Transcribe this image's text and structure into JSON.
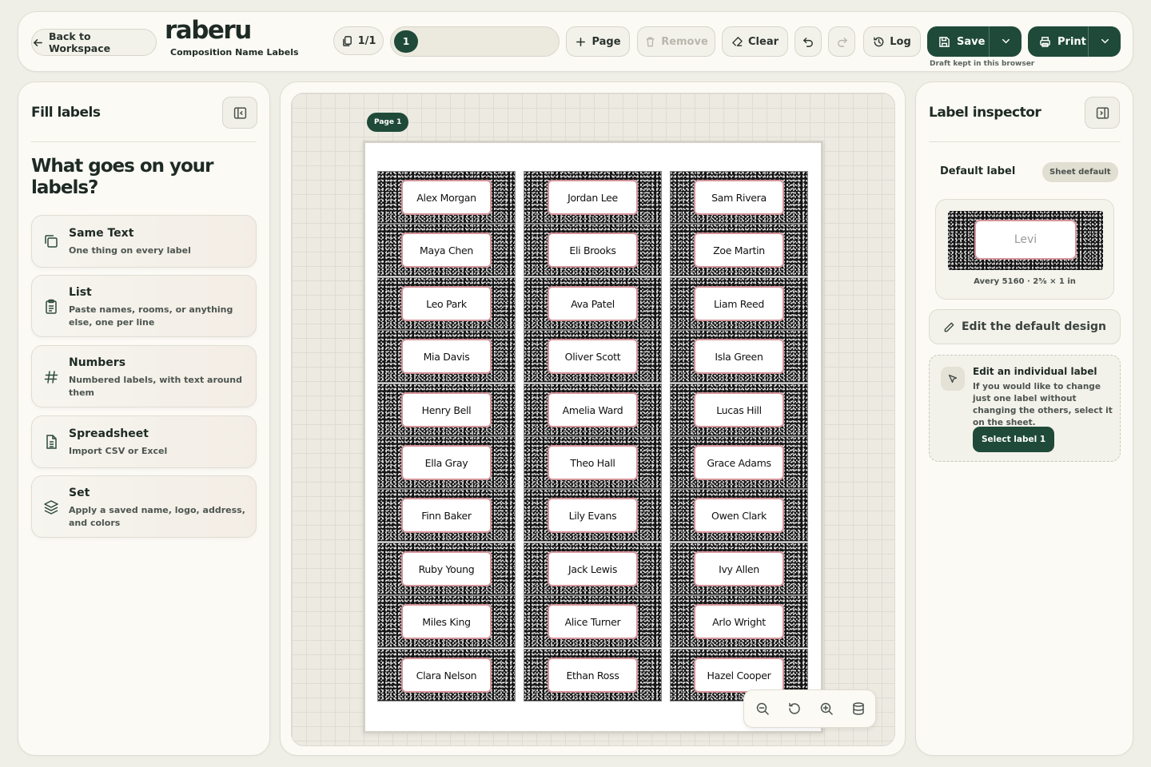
{
  "topbar": {
    "back_label": "Back to Workspace",
    "logo": "raberu",
    "subtitle": "Composition Name Labels",
    "page_count": "1/1",
    "page_chip": "1",
    "add_page_label": "Page",
    "remove_label": "Remove",
    "clear_label": "Clear",
    "log_label": "Log",
    "save_label": "Save",
    "print_label": "Print",
    "draft_note": "Draft kept in this browser"
  },
  "left": {
    "title": "Fill labels",
    "heading": "What goes on your labels?",
    "options": [
      {
        "title": "Same Text",
        "desc": "One thing on every label",
        "icon": "copy-icon"
      },
      {
        "title": "List",
        "desc": "Paste names, rooms, or anything else, one per line",
        "icon": "clipboard-list-icon"
      },
      {
        "title": "Numbers",
        "desc": "Numbered labels, with text around them",
        "icon": "hash-icon"
      },
      {
        "title": "Spreadsheet",
        "desc": "Import CSV or Excel",
        "icon": "sheet-file-icon"
      },
      {
        "title": "Set",
        "desc": "Apply a saved name, logo, address, and colors",
        "icon": "layers-icon"
      }
    ]
  },
  "canvas": {
    "page_tag": "Page 1",
    "labels": [
      [
        "Alex Morgan",
        "Jordan Lee",
        "Sam Rivera"
      ],
      [
        "Maya Chen",
        "Eli Brooks",
        "Zoe Martin"
      ],
      [
        "Leo Park",
        "Ava Patel",
        "Liam Reed"
      ],
      [
        "Mia Davis",
        "Oliver Scott",
        "Isla Green"
      ],
      [
        "Henry Bell",
        "Amelia Ward",
        "Lucas Hill"
      ],
      [
        "Ella Gray",
        "Theo Hall",
        "Grace Adams"
      ],
      [
        "Finn Baker",
        "Lily Evans",
        "Owen Clark"
      ],
      [
        "Ruby Young",
        "Jack Lewis",
        "Ivy Allen"
      ],
      [
        "Miles King",
        "Alice Turner",
        "Arlo Wright"
      ],
      [
        "Clara Nelson",
        "Ethan Ross",
        "Hazel Cooper"
      ]
    ],
    "zoom_tools": [
      "zoom-out-icon",
      "reset-icon",
      "zoom-in-icon",
      "database-icon"
    ]
  },
  "right": {
    "title": "Label inspector",
    "default_label": "Default label",
    "sheet_default_badge": "Sheet default",
    "preview_name": "Levi",
    "preview_spec": "Avery 5160 · 2⅝ × 1 in",
    "edit_default": "Edit the default design",
    "indiv_title": "Edit an individual label",
    "indiv_desc": "If you would like to change just one label without changing the others, select it on the sheet.",
    "select_button": "Select label 1"
  },
  "colors": {
    "brand_dark": "#1f4a39",
    "label_border_pink": "#d4949a",
    "background": "#efeee7"
  }
}
